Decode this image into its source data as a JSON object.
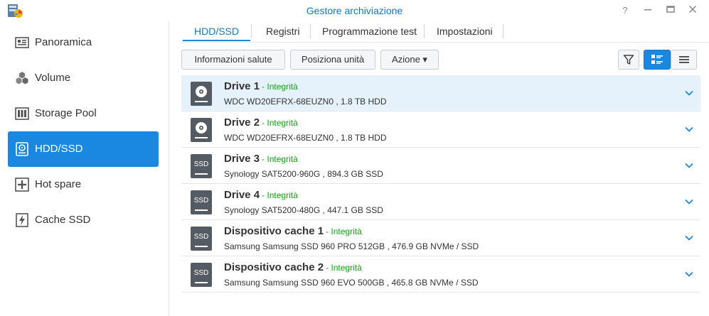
{
  "window": {
    "title": "Gestore archiviazione",
    "help_glyph": "?",
    "min_glyph": "—",
    "max_glyph": "☐",
    "close_glyph": "✕"
  },
  "sidebar": {
    "items": [
      {
        "label": "Panoramica",
        "icon": "overview-icon"
      },
      {
        "label": "Volume",
        "icon": "volume-icon"
      },
      {
        "label": "Storage Pool",
        "icon": "storage-pool-icon"
      },
      {
        "label": "HDD/SSD",
        "icon": "hdd-icon",
        "active": true
      },
      {
        "label": "Hot spare",
        "icon": "hot-spare-icon"
      },
      {
        "label": "Cache SSD",
        "icon": "cache-ssd-icon"
      }
    ]
  },
  "tabs": [
    {
      "label": "HDD/SSD",
      "active": true
    },
    {
      "label": "Registri"
    },
    {
      "label": "Programmazione test"
    },
    {
      "label": "Impostazioni"
    }
  ],
  "toolbar": {
    "health_info": "Informazioni salute",
    "locate_drive": "Posiziona unità",
    "action": "Azione ▾"
  },
  "drives": [
    {
      "name": "Drive 1",
      "status": "- Integrità",
      "desc": "WDC WD20EFRX-68EUZN0 , 1.8 TB HDD",
      "type": "hdd",
      "selected": true
    },
    {
      "name": "Drive 2",
      "status": "- Integrità",
      "desc": "WDC WD20EFRX-68EUZN0 , 1.8 TB HDD",
      "type": "hdd"
    },
    {
      "name": "Drive 3",
      "status": "- Integrità",
      "desc": "Synology SAT5200-960G , 894.3 GB SSD",
      "type": "ssd"
    },
    {
      "name": "Drive 4",
      "status": "- Integrità",
      "desc": "Synology SAT5200-480G , 447.1 GB SSD",
      "type": "ssd"
    },
    {
      "name": "Dispositivo cache 1",
      "status": "- Integrità",
      "desc": "Samsung Samsung SSD 960 PRO 512GB , 476.9 GB NVMe / SSD",
      "type": "ssd"
    },
    {
      "name": "Dispositivo cache 2",
      "status": "- Integrità",
      "desc": "Samsung Samsung SSD 960 EVO 500GB , 465.8 GB NVMe / SSD",
      "type": "ssd"
    }
  ],
  "ssd_badge": "SSD",
  "colors": {
    "accent": "#1a88e1",
    "title": "#0e79c9",
    "healthy": "#12a310",
    "selected_row": "#e5f2fc"
  }
}
